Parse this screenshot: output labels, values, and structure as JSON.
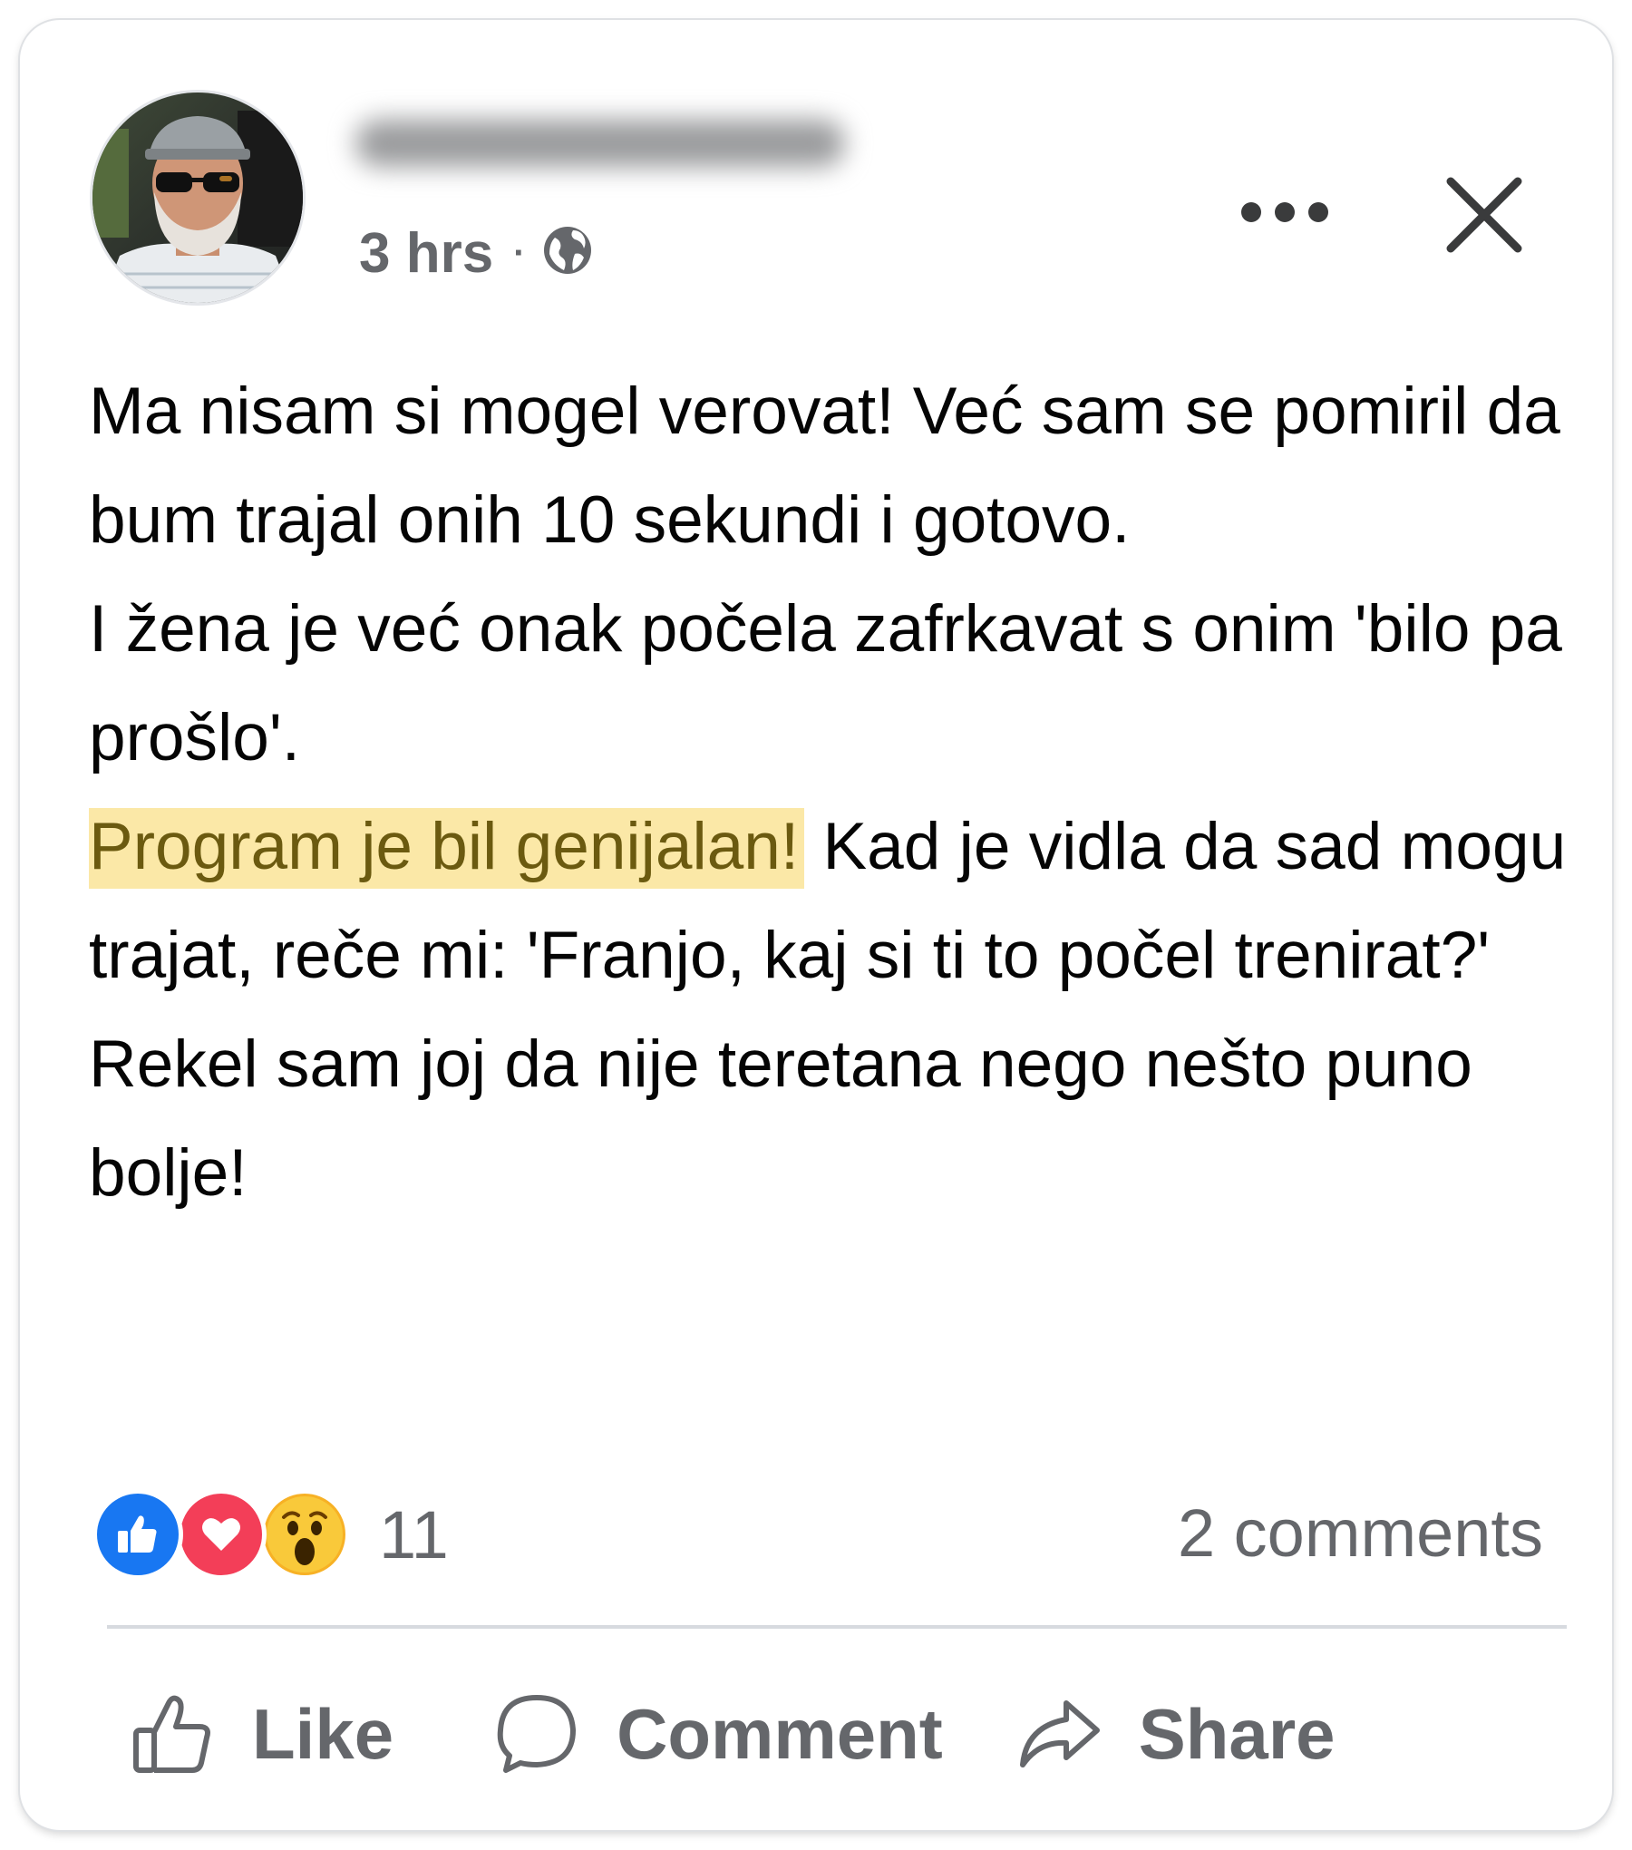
{
  "post": {
    "author_name": "",
    "timestamp": "3 hrs",
    "separator": "·",
    "audience_icon": "globe-icon",
    "body": {
      "p1": "Ma nisam si mogel verovat! Već sam se pomiril da bum trajal onih 10 sekundi i gotovo.",
      "p2": "I žena je već onak počela zafrkavat s onim 'bilo pa prošlo'.",
      "p3_highlight": "Program je bil genijalan!",
      "p3_rest": " Kad je vidla da sad mogu trajat, reče mi: 'Franjo, kaj si ti to počel trenirat?'",
      "p4": "Rekel sam joj da nije teretana nego nešto puno bolje!"
    },
    "highlight_color": "#fbe8a7"
  },
  "reactions": {
    "types": [
      "like-icon",
      "love-icon",
      "wow-icon"
    ],
    "count": "11",
    "comments": "2 comments"
  },
  "actions": {
    "like": "Like",
    "comment": "Comment",
    "share": "Share"
  },
  "colors": {
    "like_blue": "#1877f2",
    "love_red": "#f33e58",
    "wow_yellow": "#f7b125",
    "secondary_text": "#65676b"
  }
}
